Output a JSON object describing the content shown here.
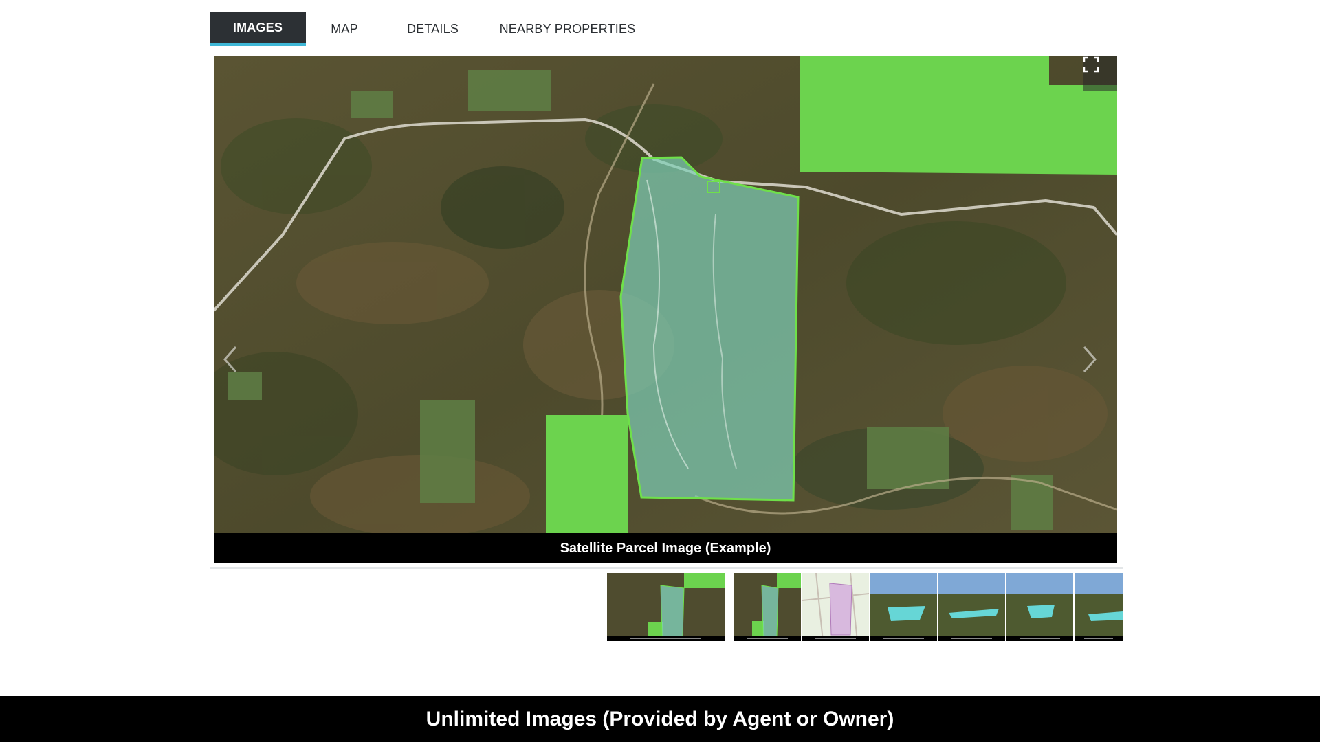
{
  "tabs": [
    {
      "label": "IMAGES",
      "active": true
    },
    {
      "label": "MAP",
      "active": false
    },
    {
      "label": "DETAILS",
      "active": false
    },
    {
      "label": "NEARBY PROPERTIES",
      "active": false
    }
  ],
  "viewer": {
    "caption": "Satellite Parcel Image (Example)",
    "fullscreen_icon": "expand-icon",
    "prev_icon": "chevron-left-icon",
    "next_icon": "chevron-right-icon"
  },
  "thumbnails": [
    {
      "kind": "satellite-parcel",
      "selected": true
    },
    {
      "kind": "satellite-parcel"
    },
    {
      "kind": "plat-map"
    },
    {
      "kind": "3d-terrain"
    },
    {
      "kind": "3d-terrain"
    },
    {
      "kind": "3d-terrain"
    },
    {
      "kind": "3d-terrain"
    }
  ],
  "banner": {
    "text": "Unlimited Images (Provided by Agent or Owner)"
  },
  "colors": {
    "tab_active_bg": "#2c3034",
    "tab_active_underline": "#3fb7d6",
    "parcel_fill": "#7fd0b8",
    "parcel_outline": "#6fe04a",
    "highlight_green": "#6cd34e"
  }
}
